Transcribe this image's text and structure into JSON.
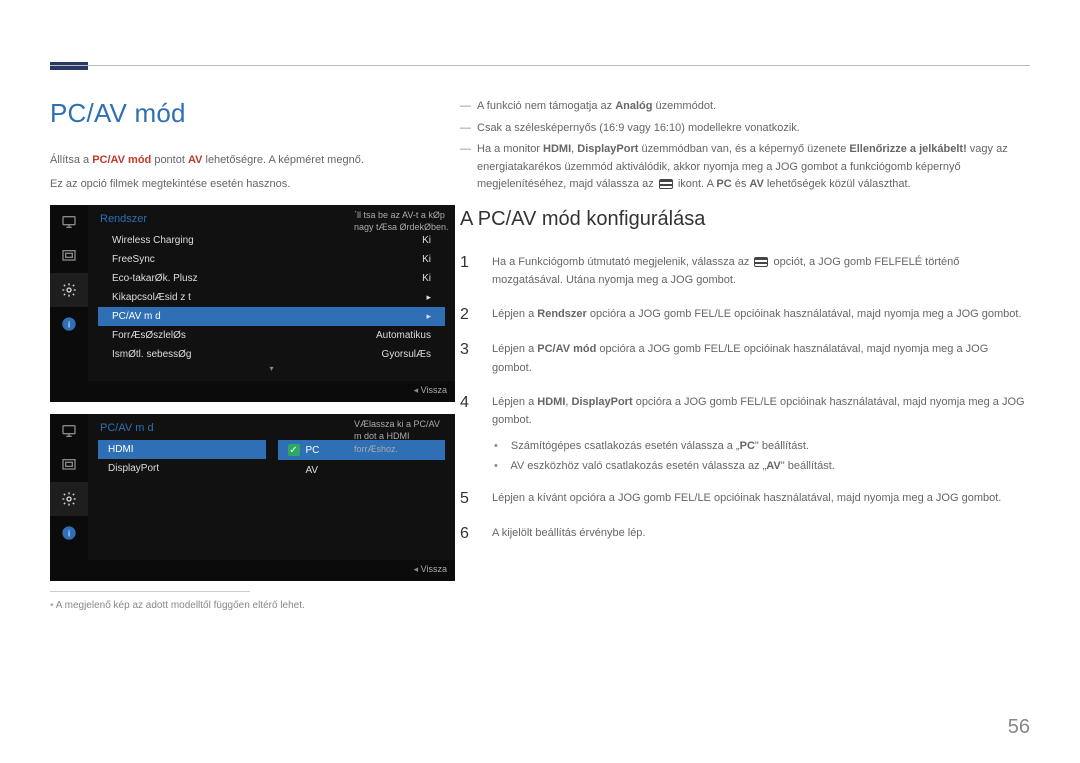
{
  "page": {
    "title": "PC/AV mód",
    "number": "56"
  },
  "left": {
    "intro1_pre": "Állítsa a ",
    "intro1_b1": "PC/AV mód",
    "intro1_mid": " pontot ",
    "intro1_b2": "AV",
    "intro1_post": " lehetőségre. A képméret megnő.",
    "intro2": "Ez az opció filmek megtekintése esetén hasznos.",
    "footnote": "A megjelenő kép az adott modelltől függően eltérő lehet."
  },
  "osd1": {
    "title": "Rendszer",
    "hint": "΄ll tsa be az AV-t a kØp nagy tÆsa ØrdekØben.",
    "rows": [
      {
        "label": "Wireless Charging",
        "value": "Ki"
      },
      {
        "label": "FreeSync",
        "value": "Ki"
      },
      {
        "label": "Eco-takarØk. Plusz",
        "value": "Ki"
      },
      {
        "label": "KikapcsolÆsid z t",
        "value": "▸"
      },
      {
        "label": "PC/AV m d",
        "value": "▸",
        "selected": true
      },
      {
        "label": "ForrÆsØszlelØs",
        "value": "Automatikus"
      },
      {
        "label": "IsmØtl. sebessØg",
        "value": "GyorsulÆs"
      }
    ],
    "footer": "Vissza"
  },
  "osd2": {
    "title": "PC/AV m d",
    "hint": "VÆlassza ki a PC/AV m dot a HDMI forrÆshoz.",
    "left_rows": [
      {
        "label": "HDMI",
        "selected": true
      },
      {
        "label": "DisplayPort"
      }
    ],
    "right_rows": [
      {
        "label": "PC",
        "selected": true
      },
      {
        "label": "AV"
      }
    ],
    "footer": "Vissza"
  },
  "right": {
    "notes": {
      "n1_pre": "A funkció nem támogatja az ",
      "n1_b": "Analóg",
      "n1_post": " üzemmódot.",
      "n2": "Csak a szélesképernyős (16:9 vagy 16:10) modellekre vonatkozik.",
      "n3_1": "Ha a monitor ",
      "n3_b1": "HDMI",
      "n3_2": ", ",
      "n3_b2": "DisplayPort",
      "n3_3": " üzemmódban van, és a képernyő üzenete ",
      "n3_b3": "Ellenőrizze a jelkábelt!",
      "n3_4": " vagy az energiatakarékos üzemmód aktiválódik, akkor nyomja meg a JOG gombot a funkciógomb képernyő megjelenítéséhez, majd válassza az ",
      "n3_5": " ikont. A ",
      "n3_b4": "PC",
      "n3_6": " és ",
      "n3_b5": "AV",
      "n3_7": " lehetőségek közül választhat."
    },
    "section_title": "A PC/AV mód konfigurálása",
    "steps": {
      "s1_pre": "Ha a Funkciógomb útmutató megjelenik, válassza az ",
      "s1_post": " opciót, a JOG gomb FELFELÉ történő mozgatásával. Utána nyomja meg a JOG gombot.",
      "s2_pre": "Lépjen a ",
      "s2_b": "Rendszer",
      "s2_post": " opcióra a JOG gomb FEL/LE opcióinak használatával, majd nyomja meg a JOG gombot.",
      "s3_pre": "Lépjen a ",
      "s3_b": "PC/AV mód",
      "s3_post": " opcióra a JOG gomb FEL/LE opcióinak használatával, majd nyomja meg a JOG gombot.",
      "s4_pre": "Lépjen a ",
      "s4_b1": "HDMI",
      "s4_mid": ", ",
      "s4_b2": "DisplayPort",
      "s4_post": " opcióra a JOG gomb FEL/LE opcióinak használatával, majd nyomja meg a JOG gombot.",
      "bul1_pre": "Számítógépes csatlakozás esetén válassza a „",
      "bul1_b": "PC",
      "bul1_post": "\" beállítást.",
      "bul2_pre": "AV eszközhöz való csatlakozás esetén válassza az „",
      "bul2_b": "AV",
      "bul2_post": "\" beállítást.",
      "s5": "Lépjen a kívánt opcióra a JOG gomb FEL/LE opcióinak használatával, majd nyomja meg a JOG gombot.",
      "s6": "A kijelölt beállítás érvénybe lép."
    }
  }
}
